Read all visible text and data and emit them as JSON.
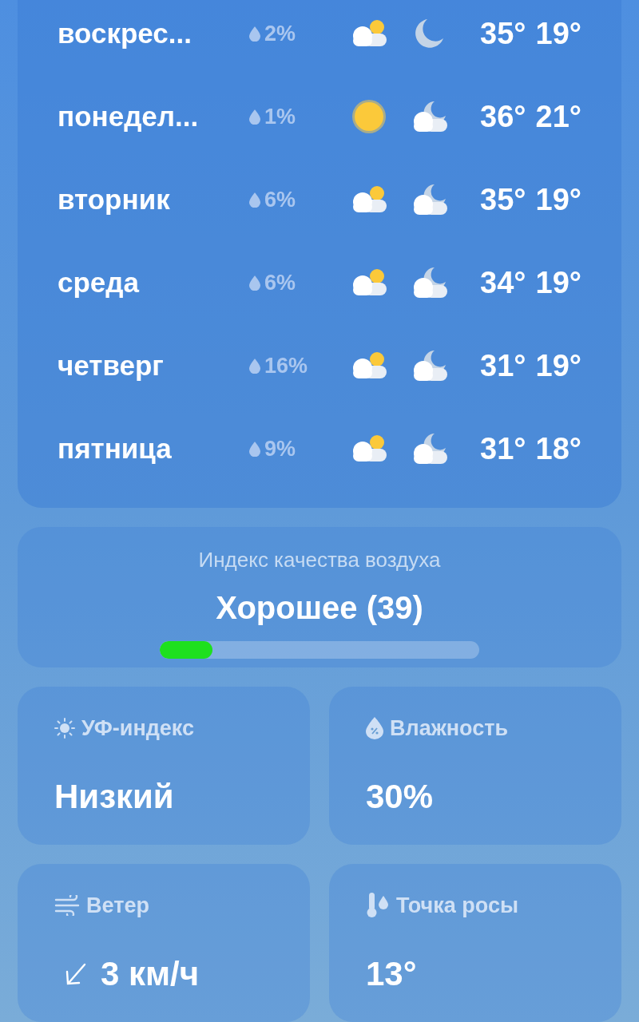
{
  "forecast": [
    {
      "day": "воскрес...",
      "precip": "2%",
      "day_icon": {
        "kind": "partly-cloudy"
      },
      "night_icon": {
        "kind": "moon"
      },
      "high": "35°",
      "low": "19°"
    },
    {
      "day": "понедел...",
      "precip": "1%",
      "day_icon": {
        "kind": "sunny"
      },
      "night_icon": {
        "kind": "cloudy-moon"
      },
      "high": "36°",
      "low": "21°"
    },
    {
      "day": "вторник",
      "precip": "6%",
      "day_icon": {
        "kind": "partly-cloudy"
      },
      "night_icon": {
        "kind": "cloudy-moon"
      },
      "high": "35°",
      "low": "19°"
    },
    {
      "day": "среда",
      "precip": "6%",
      "day_icon": {
        "kind": "partly-cloudy"
      },
      "night_icon": {
        "kind": "cloudy-moon"
      },
      "high": "34°",
      "low": "19°"
    },
    {
      "day": "четверг",
      "precip": "16%",
      "day_icon": {
        "kind": "partly-cloudy"
      },
      "night_icon": {
        "kind": "cloudy-moon"
      },
      "high": "31°",
      "low": "19°"
    },
    {
      "day": "пятница",
      "precip": "9%",
      "day_icon": {
        "kind": "partly-cloudy"
      },
      "night_icon": {
        "kind": "cloudy-moon"
      },
      "high": "31°",
      "low": "18°"
    }
  ],
  "air_quality": {
    "title": "Индекс качества воздуха",
    "value": "Хорошее (39)",
    "level": 0.165,
    "color": "#1ee01e"
  },
  "tiles": [
    {
      "kind": "uv",
      "label": "УФ-индекс",
      "value": "Низкий"
    },
    {
      "kind": "humidity",
      "label": "Влажность",
      "value": "30%"
    },
    {
      "kind": "wind",
      "label": "Ветер",
      "value": "3 км/ч"
    },
    {
      "kind": "dew",
      "label": "Точка росы",
      "value": "13°"
    }
  ]
}
